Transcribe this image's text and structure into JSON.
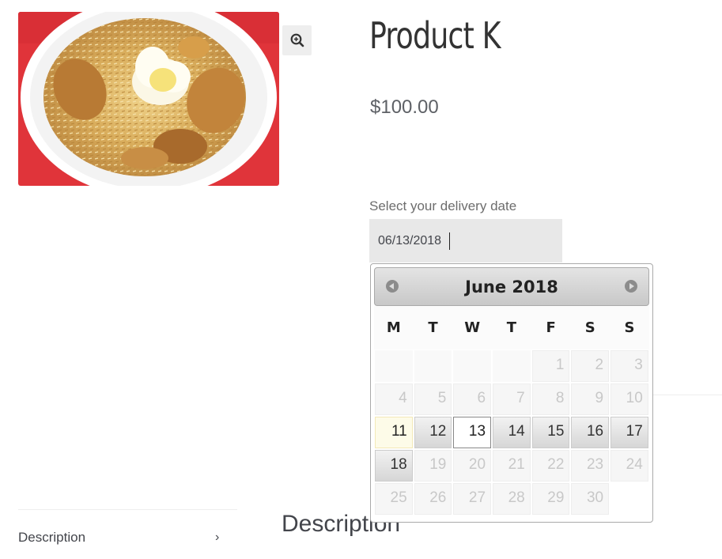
{
  "product": {
    "title": "Product K",
    "price": "$100.00",
    "zoom_icon": "zoom-in-icon"
  },
  "delivery": {
    "label": "Select your delivery date",
    "value": "06/13/2018"
  },
  "calendar": {
    "month_title": "June 2018",
    "prev_icon": "circle-arrow-left-icon",
    "next_icon": "circle-arrow-right-icon",
    "weekdays": [
      "M",
      "T",
      "W",
      "T",
      "F",
      "S",
      "S"
    ],
    "weeks": [
      [
        {
          "d": "",
          "s": "empty"
        },
        {
          "d": "",
          "s": "empty"
        },
        {
          "d": "",
          "s": "empty"
        },
        {
          "d": "",
          "s": "empty"
        },
        {
          "d": "1",
          "s": "disabled"
        },
        {
          "d": "2",
          "s": "disabled"
        },
        {
          "d": "3",
          "s": "disabled"
        }
      ],
      [
        {
          "d": "4",
          "s": "disabled"
        },
        {
          "d": "5",
          "s": "disabled"
        },
        {
          "d": "6",
          "s": "disabled"
        },
        {
          "d": "7",
          "s": "disabled"
        },
        {
          "d": "8",
          "s": "disabled"
        },
        {
          "d": "9",
          "s": "disabled"
        },
        {
          "d": "10",
          "s": "disabled"
        }
      ],
      [
        {
          "d": "11",
          "s": "today"
        },
        {
          "d": "12",
          "s": "active"
        },
        {
          "d": "13",
          "s": "selected"
        },
        {
          "d": "14",
          "s": "active"
        },
        {
          "d": "15",
          "s": "active"
        },
        {
          "d": "16",
          "s": "active"
        },
        {
          "d": "17",
          "s": "active"
        }
      ],
      [
        {
          "d": "18",
          "s": "active"
        },
        {
          "d": "19",
          "s": "disabled"
        },
        {
          "d": "20",
          "s": "disabled"
        },
        {
          "d": "21",
          "s": "disabled"
        },
        {
          "d": "22",
          "s": "disabled"
        },
        {
          "d": "23",
          "s": "disabled"
        },
        {
          "d": "24",
          "s": "disabled"
        }
      ],
      [
        {
          "d": "25",
          "s": "disabled"
        },
        {
          "d": "26",
          "s": "disabled"
        },
        {
          "d": "27",
          "s": "disabled"
        },
        {
          "d": "28",
          "s": "disabled"
        },
        {
          "d": "29",
          "s": "disabled"
        },
        {
          "d": "30",
          "s": "disabled"
        },
        {
          "d": "",
          "s": "blank"
        }
      ]
    ]
  },
  "tabs": {
    "description_label": "Description",
    "chevron_icon": "chevron-right-icon"
  },
  "section": {
    "heading": "Description"
  },
  "colors": {
    "plate_background": "#e0343a",
    "rice": "#e0b864",
    "datepicker_header": "#d4d4d4"
  }
}
